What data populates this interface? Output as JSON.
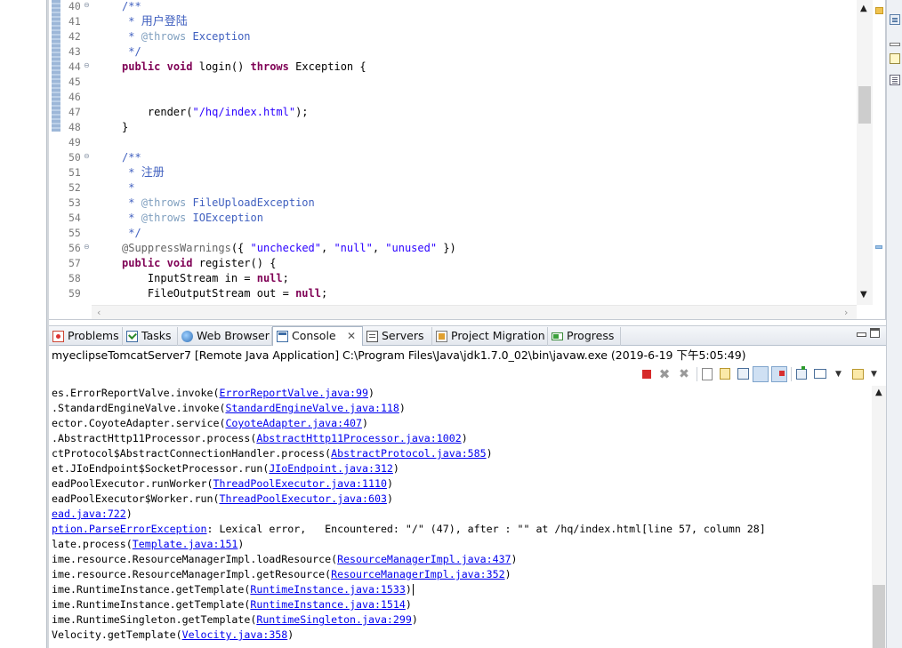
{
  "editor": {
    "lines": [
      {
        "num": "40",
        "fold": "⊖",
        "segments": [
          [
            "cm",
            "/**"
          ]
        ]
      },
      {
        "num": "41",
        "fold": "",
        "segments": [
          [
            "cm",
            " * "
          ],
          [
            "cn",
            "用户登陆"
          ]
        ]
      },
      {
        "num": "42",
        "fold": "",
        "segments": [
          [
            "cm",
            " * "
          ],
          [
            "tag",
            "@throws"
          ],
          [
            "cm",
            " Exception"
          ]
        ]
      },
      {
        "num": "43",
        "fold": "",
        "segments": [
          [
            "cm",
            " */"
          ]
        ]
      },
      {
        "num": "44",
        "fold": "⊖",
        "segments": [
          [
            "kw",
            "public"
          ],
          [
            "",
            " "
          ],
          [
            "kw",
            "void"
          ],
          [
            "",
            " login() "
          ],
          [
            "kw",
            "throws"
          ],
          [
            "",
            " Exception {"
          ]
        ]
      },
      {
        "num": "45",
        "fold": "",
        "segments": []
      },
      {
        "num": "46",
        "fold": "",
        "segments": []
      },
      {
        "num": "47",
        "fold": "",
        "segments": [
          [
            "",
            "    render("
          ],
          [
            "str",
            "\"/hq/index.html\""
          ],
          [
            "",
            ");"
          ]
        ]
      },
      {
        "num": "48",
        "fold": "",
        "segments": [
          [
            "",
            "}"
          ]
        ]
      },
      {
        "num": "49",
        "fold": "",
        "segments": []
      },
      {
        "num": "50",
        "fold": "⊖",
        "segments": [
          [
            "cm",
            "/**"
          ]
        ]
      },
      {
        "num": "51",
        "fold": "",
        "segments": [
          [
            "cm",
            " * "
          ],
          [
            "cn",
            "注册"
          ]
        ]
      },
      {
        "num": "52",
        "fold": "",
        "segments": [
          [
            "cm",
            " *"
          ]
        ]
      },
      {
        "num": "53",
        "fold": "",
        "segments": [
          [
            "cm",
            " * "
          ],
          [
            "tag",
            "@throws"
          ],
          [
            "cm",
            " FileUploadException"
          ]
        ]
      },
      {
        "num": "54",
        "fold": "",
        "segments": [
          [
            "cm",
            " * "
          ],
          [
            "tag",
            "@throws"
          ],
          [
            "cm",
            " IOException"
          ]
        ]
      },
      {
        "num": "55",
        "fold": "",
        "segments": [
          [
            "cm",
            " */"
          ]
        ]
      },
      {
        "num": "56",
        "fold": "⊖",
        "segments": [
          [
            "ann",
            "@SuppressWarnings"
          ],
          [
            "",
            "({ "
          ],
          [
            "str",
            "\"unchecked\""
          ],
          [
            "",
            ", "
          ],
          [
            "str",
            "\"null\""
          ],
          [
            "",
            ", "
          ],
          [
            "str",
            "\"unused\""
          ],
          [
            "",
            " })"
          ]
        ]
      },
      {
        "num": "57",
        "fold": "",
        "segments": [
          [
            "kw",
            "public"
          ],
          [
            "",
            " "
          ],
          [
            "kw",
            "void"
          ],
          [
            "",
            " register() {"
          ]
        ]
      },
      {
        "num": "58",
        "fold": "",
        "segments": [
          [
            "",
            "    InputStream in = "
          ],
          [
            "kw",
            "null"
          ],
          [
            "",
            ";"
          ]
        ]
      },
      {
        "num": "59",
        "fold": "",
        "segments": [
          [
            "",
            "    FileOutputStream out = "
          ],
          [
            "kw",
            "null"
          ],
          [
            "",
            ";"
          ]
        ]
      }
    ]
  },
  "tabs": [
    {
      "label": "Problems",
      "icon": "problems-icon"
    },
    {
      "label": "Tasks",
      "icon": "tasks-icon"
    },
    {
      "label": "Web Browser",
      "icon": "web-browser-icon"
    },
    {
      "label": "Console",
      "icon": "console-icon",
      "active": true,
      "close": "✕"
    },
    {
      "label": "Servers",
      "icon": "servers-icon"
    },
    {
      "label": "Project Migration",
      "icon": "project-migration-icon"
    },
    {
      "label": "Progress",
      "icon": "progress-icon"
    }
  ],
  "console": {
    "launch_description": "myeclipseTomcatServer7 [Remote Java Application] C:\\Program Files\\Java\\jdk1.7.0_02\\bin\\javaw.exe (2019-6-19 下午5:05:49)",
    "lines": [
      [
        [
          "",
          "es.ErrorReportValve.invoke("
        ],
        [
          "lnk",
          "ErrorReportValve.java:99"
        ],
        [
          "",
          ")"
        ]
      ],
      [
        [
          "",
          ".StandardEngineValve.invoke("
        ],
        [
          "lnk",
          "StandardEngineValve.java:118"
        ],
        [
          "",
          ")"
        ]
      ],
      [
        [
          "",
          "ector.CoyoteAdapter.service("
        ],
        [
          "lnk",
          "CoyoteAdapter.java:407"
        ],
        [
          "",
          ")"
        ]
      ],
      [
        [
          "",
          ".AbstractHttp11Processor.process("
        ],
        [
          "lnk",
          "AbstractHttp11Processor.java:1002"
        ],
        [
          "",
          ")"
        ]
      ],
      [
        [
          "",
          "ctProtocol$AbstractConnectionHandler.process("
        ],
        [
          "lnk",
          "AbstractProtocol.java:585"
        ],
        [
          "",
          ")"
        ]
      ],
      [
        [
          "",
          "et.JIoEndpoint$SocketProcessor.run("
        ],
        [
          "lnk",
          "JIoEndpoint.java:312"
        ],
        [
          "",
          ")"
        ]
      ],
      [
        [
          "",
          "eadPoolExecutor.runWorker("
        ],
        [
          "lnk",
          "ThreadPoolExecutor.java:1110"
        ],
        [
          "",
          ")"
        ]
      ],
      [
        [
          "",
          "eadPoolExecutor$Worker.run("
        ],
        [
          "lnk",
          "ThreadPoolExecutor.java:603"
        ],
        [
          "",
          ")"
        ]
      ],
      [
        [
          "lnk",
          "ead.java:722"
        ],
        [
          "",
          ")"
        ]
      ],
      [
        [
          "lnk",
          "ption.ParseErrorException"
        ],
        [
          "",
          ": Lexical error,   Encountered: \"/\" (47), after : \"\" at /hq/index.html[line 57, column 28]"
        ]
      ],
      [
        [
          "",
          "late.process("
        ],
        [
          "lnk",
          "Template.java:151"
        ],
        [
          "",
          ")"
        ]
      ],
      [
        [
          "",
          "ime.resource.ResourceManagerImpl.loadResource("
        ],
        [
          "lnk",
          "ResourceManagerImpl.java:437"
        ],
        [
          "",
          ")"
        ]
      ],
      [
        [
          "",
          "ime.resource.ResourceManagerImpl.getResource("
        ],
        [
          "lnk",
          "ResourceManagerImpl.java:352"
        ],
        [
          "",
          ")"
        ]
      ],
      [
        [
          "",
          "ime.RuntimeInstance.getTemplate("
        ],
        [
          "lnk",
          "RuntimeInstance.java:1533"
        ],
        [
          "",
          ")"
        ],
        [
          "caret",
          ""
        ]
      ],
      [
        [
          "",
          "ime.RuntimeInstance.getTemplate("
        ],
        [
          "lnk",
          "RuntimeInstance.java:1514"
        ],
        [
          "",
          ")"
        ]
      ],
      [
        [
          "",
          "ime.RuntimeSingleton.getTemplate("
        ],
        [
          "lnk",
          "RuntimeSingleton.java:299"
        ],
        [
          "",
          ")"
        ]
      ],
      [
        [
          "",
          "Velocity.getTemplate("
        ],
        [
          "lnk",
          "Velocity.java:358"
        ],
        [
          "",
          ")"
        ]
      ]
    ]
  },
  "colors": {
    "keyword": "#7f0055",
    "comment": "#3f5fbf",
    "string": "#2a00ff",
    "link": "#0000ee",
    "terminate": "#d62a2a"
  }
}
